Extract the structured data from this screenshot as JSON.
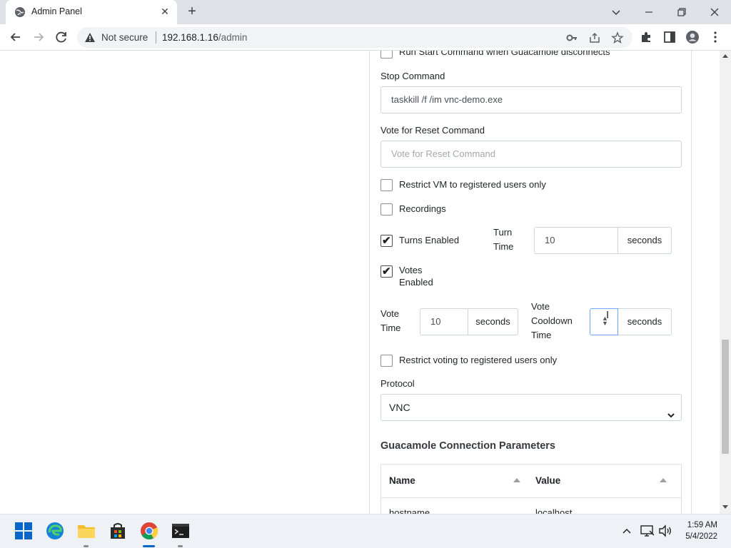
{
  "browser": {
    "tab_title": "Admin Panel",
    "omnibox": {
      "security_label": "Not secure",
      "url_host": "192.168.1.16",
      "url_path": "/admin"
    }
  },
  "form": {
    "run_start_command": {
      "label": "Run Start Command when Guacamole disconnects",
      "checked": false
    },
    "stop_command": {
      "label": "Stop Command",
      "value": "taskkill /f /im vnc-demo.exe"
    },
    "vote_reset_command": {
      "label": "Vote for Reset Command",
      "placeholder": "Vote for Reset Command",
      "value": ""
    },
    "restrict_vm": {
      "label": "Restrict VM to registered users only",
      "checked": false
    },
    "recordings": {
      "label": "Recordings",
      "checked": false
    },
    "turns_enabled": {
      "label": "Turns Enabled",
      "checked": true
    },
    "turn_time": {
      "label_line1": "Turn",
      "label_line2": "Time",
      "value": "10",
      "unit": "seconds"
    },
    "votes_enabled": {
      "label_line1": "Votes",
      "label_line2": "Enabled",
      "checked": true
    },
    "vote_time": {
      "label_line1": "Vote",
      "label_line2": "Time",
      "value": "10",
      "unit": "seconds"
    },
    "vote_cooldown": {
      "label_line1": "Vote",
      "label_line2": "Cooldown",
      "label_line3": "Time",
      "value": "",
      "unit": "seconds"
    },
    "restrict_voting": {
      "label": "Restrict voting to registered users only",
      "checked": false
    },
    "protocol": {
      "label": "Protocol",
      "selected": "VNC"
    }
  },
  "guac_params": {
    "title": "Guacamole Connection Parameters",
    "columns": [
      "Name",
      "Value"
    ],
    "rows": [
      {
        "name": "hostname",
        "value": "localhost"
      }
    ]
  },
  "taskbar": {
    "time": "1:59 AM",
    "date": "5/4/2022"
  }
}
